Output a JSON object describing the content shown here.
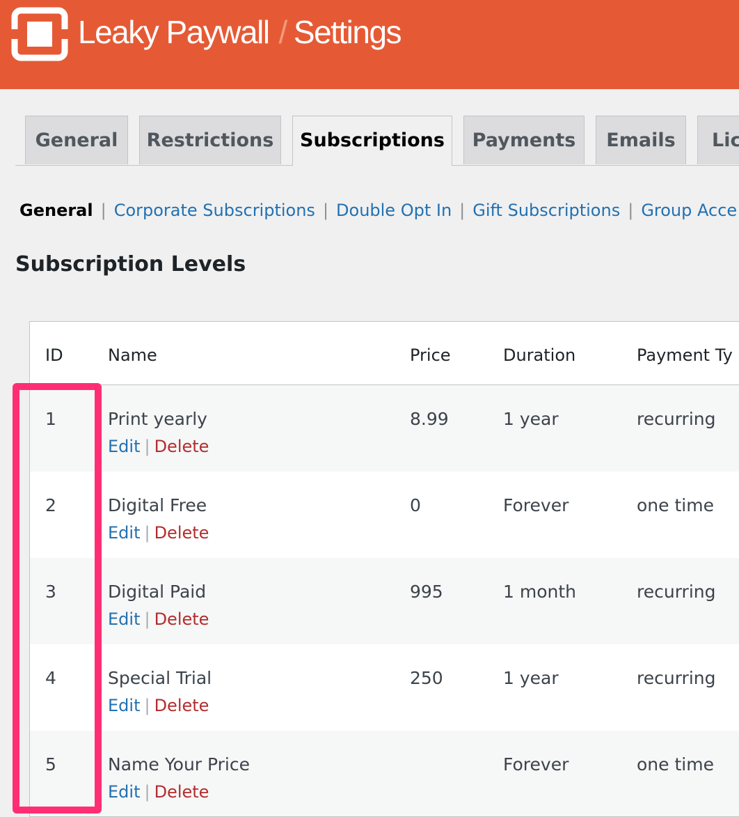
{
  "header": {
    "brand": "Leaky Paywall",
    "separator": "/",
    "page": "Settings",
    "color": "#e55a35",
    "logo_icon": "leaky-paywall-logo-icon"
  },
  "tabs": [
    {
      "label": "General"
    },
    {
      "label": "Restrictions"
    },
    {
      "label": "Subscriptions",
      "active": true
    },
    {
      "label": "Payments"
    },
    {
      "label": "Emails"
    },
    {
      "label": "Lic"
    }
  ],
  "subnav": {
    "current": "General",
    "links": [
      "Corporate Subscriptions",
      "Double Opt In",
      "Gift Subscriptions",
      "Group Acce"
    ]
  },
  "section_title": "Subscription Levels",
  "table": {
    "headers": [
      "ID",
      "Name",
      "Price",
      "Duration",
      "Payment Ty"
    ],
    "edit_label": "Edit",
    "delete_label": "Delete",
    "action_separator": "|",
    "rows": [
      {
        "id": "1",
        "name": "Print yearly",
        "price": "8.99",
        "duration": "1 year",
        "payment": "recurring"
      },
      {
        "id": "2",
        "name": "Digital Free",
        "price": "0",
        "duration": "Forever",
        "payment": "one time"
      },
      {
        "id": "3",
        "name": "Digital Paid",
        "price": "995",
        "duration": "1 month",
        "payment": "recurring"
      },
      {
        "id": "4",
        "name": "Special Trial",
        "price": "250",
        "duration": "1 year",
        "payment": "recurring"
      },
      {
        "id": "5",
        "name": "Name Your Price",
        "price": "",
        "duration": "Forever",
        "payment": "one time"
      }
    ]
  },
  "highlight_color": "#ff2e74"
}
